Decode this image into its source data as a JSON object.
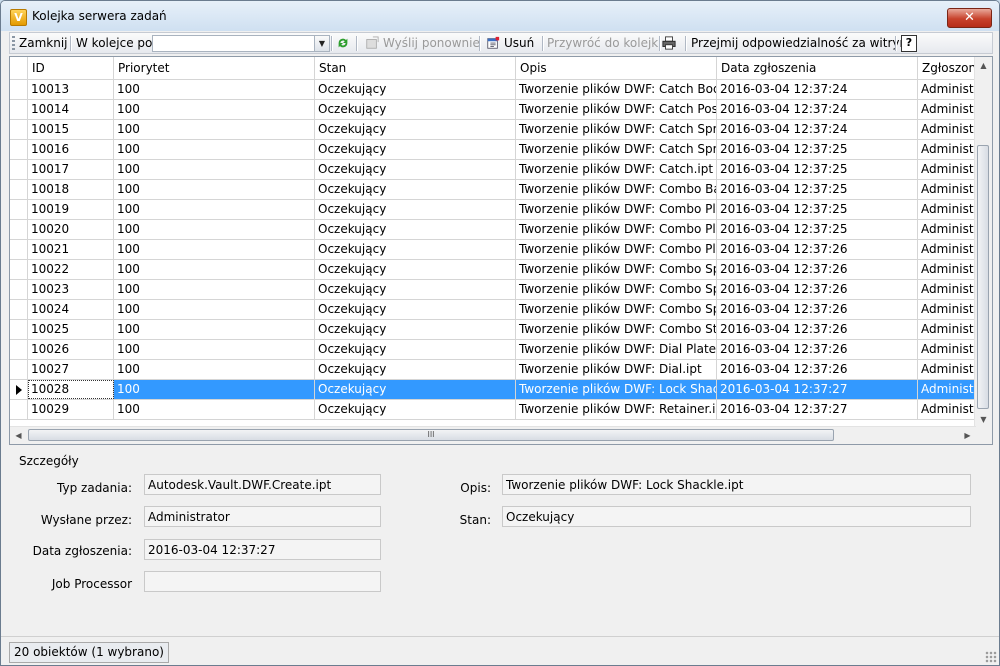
{
  "window": {
    "title": "Kolejka serwera zadań",
    "app_icon_letter": "V",
    "close_symbol": "✕"
  },
  "toolbar": {
    "close_label": "Zamknij",
    "queue_label": "W kolejce po:",
    "queue_value": "",
    "resend_label": "Wyślij ponownie",
    "delete_label": "Usuń",
    "restore_label": "Przywróć do kolejki",
    "take_ownership_label": "Przejmij odpowiedzialność za witrynę",
    "help_symbol": "?"
  },
  "grid": {
    "columns": [
      "ID",
      "Priorytet",
      "Stan",
      "Opis",
      "Data zgłoszenia",
      "Zgłoszony prz"
    ],
    "rows": [
      [
        "10013",
        "100",
        "Oczekujący",
        "Tworzenie plików DWF: Catch Bod...",
        "2016-03-04 12:37:24",
        "Administra"
      ],
      [
        "10014",
        "100",
        "Oczekujący",
        "Tworzenie plików DWF: Catch Post...",
        "2016-03-04 12:37:24",
        "Administra"
      ],
      [
        "10015",
        "100",
        "Oczekujący",
        "Tworzenie plików DWF: Catch Spri...",
        "2016-03-04 12:37:24",
        "Administra"
      ],
      [
        "10016",
        "100",
        "Oczekujący",
        "Tworzenie plików DWF: Catch Spri...",
        "2016-03-04 12:37:25",
        "Administra"
      ],
      [
        "10017",
        "100",
        "Oczekujący",
        "Tworzenie plików DWF: Catch.ipt",
        "2016-03-04 12:37:25",
        "Administra"
      ],
      [
        "10018",
        "100",
        "Oczekujący",
        "Tworzenie plików DWF: Combo Ba...",
        "2016-03-04 12:37:25",
        "Administra"
      ],
      [
        "10019",
        "100",
        "Oczekujący",
        "Tworzenie plików DWF: Combo Pla...",
        "2016-03-04 12:37:25",
        "Administra"
      ],
      [
        "10020",
        "100",
        "Oczekujący",
        "Tworzenie plików DWF: Combo Pla...",
        "2016-03-04 12:37:25",
        "Administra"
      ],
      [
        "10021",
        "100",
        "Oczekujący",
        "Tworzenie plików DWF: Combo Pla...",
        "2016-03-04 12:37:26",
        "Administra"
      ],
      [
        "10022",
        "100",
        "Oczekujący",
        "Tworzenie plików DWF: Combo Sp...",
        "2016-03-04 12:37:26",
        "Administra"
      ],
      [
        "10023",
        "100",
        "Oczekujący",
        "Tworzenie plików DWF: Combo Sp...",
        "2016-03-04 12:37:26",
        "Administra"
      ],
      [
        "10024",
        "100",
        "Oczekujący",
        "Tworzenie plików DWF: Combo Spr...",
        "2016-03-04 12:37:26",
        "Administra"
      ],
      [
        "10025",
        "100",
        "Oczekujący",
        "Tworzenie plików DWF: Combo Sta...",
        "2016-03-04 12:37:26",
        "Administra"
      ],
      [
        "10026",
        "100",
        "Oczekujący",
        "Tworzenie plików DWF: Dial Plate.ipt",
        "2016-03-04 12:37:26",
        "Administra"
      ],
      [
        "10027",
        "100",
        "Oczekujący",
        "Tworzenie plików DWF: Dial.ipt",
        "2016-03-04 12:37:26",
        "Administra"
      ],
      [
        "10028",
        "100",
        "Oczekujący",
        "Tworzenie plików DWF: Lock Shack...",
        "2016-03-04 12:37:27",
        "Administra"
      ],
      [
        "10029",
        "100",
        "Oczekujący",
        "Tworzenie plików DWF: Retainer.ipt",
        "2016-03-04 12:37:27",
        "Administra"
      ]
    ],
    "selected_row_index": 15,
    "hscroll_grip": "III"
  },
  "details": {
    "title": "Szczegóły",
    "job_type_label": "Typ zadania:",
    "job_type_value": "Autodesk.Vault.DWF.Create.ipt",
    "sent_by_label": "Wysłane przez:",
    "sent_by_value": "Administrator",
    "submit_date_label": "Data zgłoszenia:",
    "submit_date_value": "2016-03-04 12:37:27",
    "job_processor_label": "Job Processor",
    "job_processor_value": "",
    "desc_label": "Opis:",
    "desc_value": "Tworzenie plików DWF: Lock Shackle.ipt",
    "state_label": "Stan:",
    "state_value": "Oczekujący"
  },
  "status": {
    "text": "20 obiektów (1 wybrano)"
  },
  "colors": {
    "selection": "#3399ff",
    "close_button": "#c7412b"
  }
}
